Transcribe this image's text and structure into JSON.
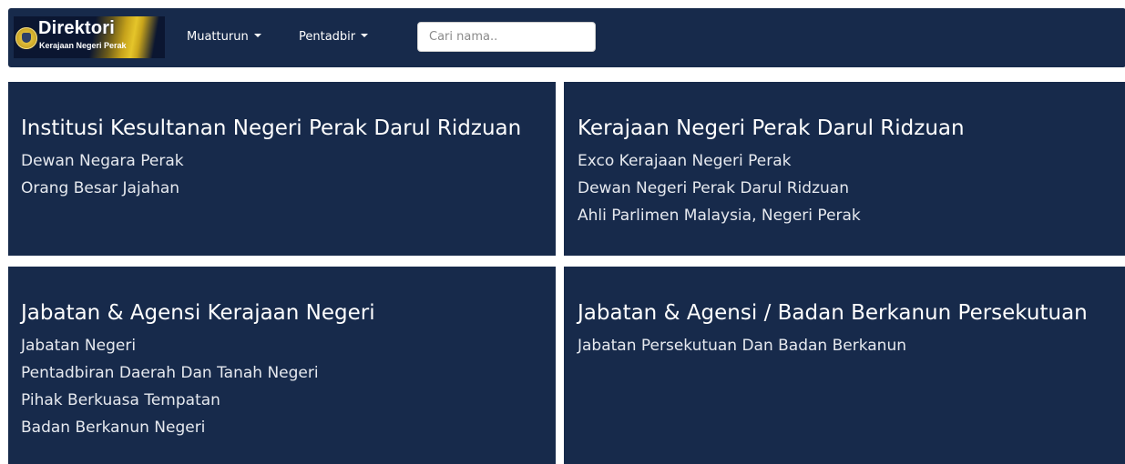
{
  "navbar": {
    "logo": {
      "title": "Direktori",
      "subtitle": "Kerajaan Negeri Perak",
      "emblem_icon": "perak-crest-icon"
    },
    "menus": [
      {
        "label": "Muatturun",
        "icon": "caret-down-icon"
      },
      {
        "label": "Pentadbir",
        "icon": "caret-down-icon"
      }
    ],
    "search": {
      "placeholder": "Cari nama..",
      "value": ""
    }
  },
  "colors": {
    "navbar_bg": "#172a4b",
    "card_bg": "#172a4b",
    "text": "#ffffff",
    "logo_gold": "#e5c52a"
  },
  "cards": [
    {
      "title": "Institusi Kesultanan Negeri Perak Darul Ridzuan",
      "links": [
        "Dewan Negara Perak",
        "Orang Besar Jajahan"
      ]
    },
    {
      "title": "Kerajaan Negeri Perak Darul Ridzuan",
      "links": [
        "Exco Kerajaan Negeri Perak",
        "Dewan Negeri Perak Darul Ridzuan",
        "Ahli Parlimen Malaysia, Negeri Perak"
      ]
    },
    {
      "title": "Jabatan & Agensi Kerajaan Negeri",
      "links": [
        "Jabatan Negeri",
        "Pentadbiran Daerah Dan Tanah Negeri",
        "Pihak Berkuasa Tempatan",
        "Badan Berkanun Negeri"
      ]
    },
    {
      "title": "Jabatan & Agensi / Badan Berkanun Persekutuan",
      "links": [
        "Jabatan Persekutuan Dan Badan Berkanun"
      ]
    }
  ]
}
